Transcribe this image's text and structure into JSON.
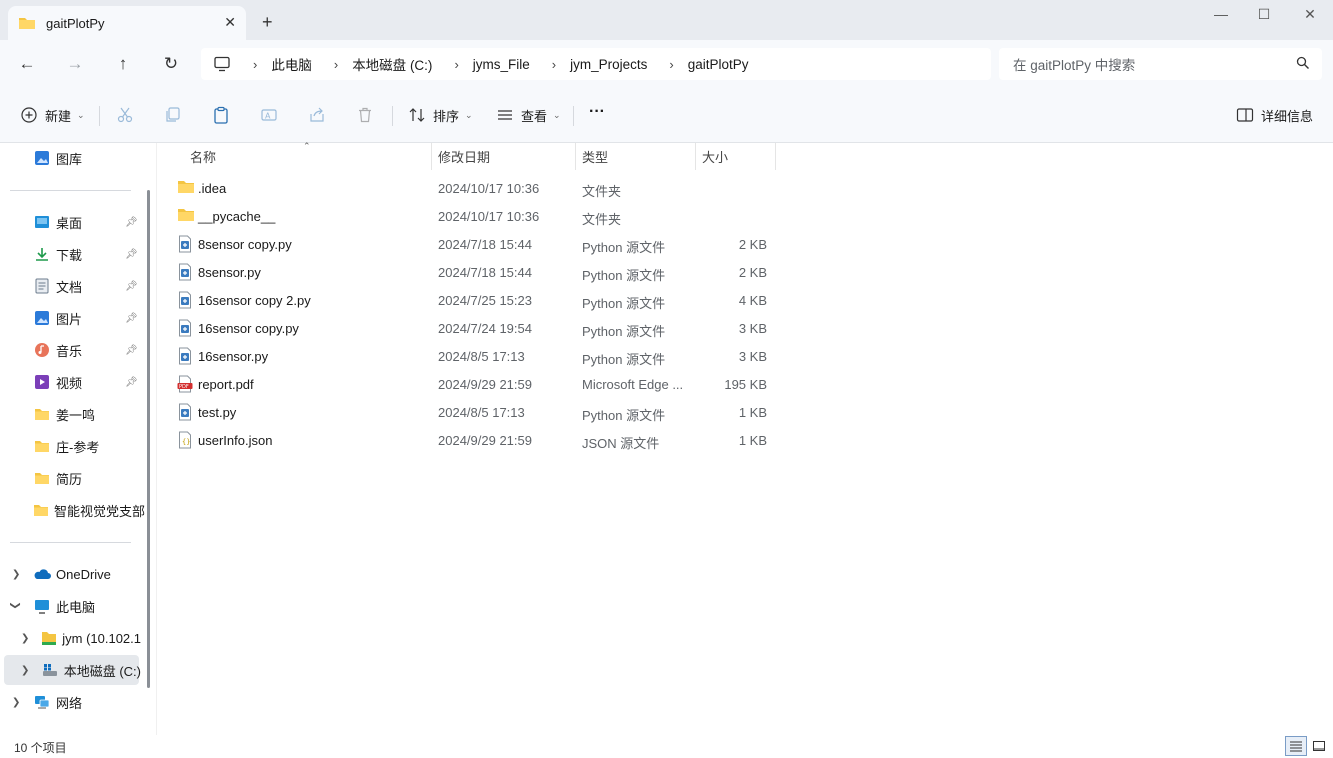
{
  "window": {
    "tab_title": "gaitPlotPy",
    "close_tab": "✕",
    "new_tab": "+",
    "minimize": "—",
    "maximize": "☐",
    "close": "✕"
  },
  "nav": {
    "back": "←",
    "forward": "→",
    "up": "↑",
    "refresh": "↻"
  },
  "breadcrumb": [
    "此电脑",
    "本地磁盘 (C:)",
    "jyms_File",
    "jym_Projects",
    "gaitPlotPy"
  ],
  "search": {
    "placeholder": "在 gaitPlotPy 中搜索"
  },
  "toolbar": {
    "new_label": "新建",
    "sort_label": "排序",
    "view_label": "查看",
    "more_label": "···",
    "details_label": "详细信息"
  },
  "sidebar": {
    "top_item": {
      "label": "图库",
      "icon": "gallery-icon"
    },
    "quick_access": [
      {
        "label": "桌面",
        "icon": "desktop-icon",
        "pinned": true
      },
      {
        "label": "下载",
        "icon": "download-icon",
        "pinned": true
      },
      {
        "label": "文档",
        "icon": "document-icon",
        "pinned": true
      },
      {
        "label": "图片",
        "icon": "picture-icon",
        "pinned": true
      },
      {
        "label": "音乐",
        "icon": "music-icon",
        "pinned": true
      },
      {
        "label": "视频",
        "icon": "video-icon",
        "pinned": true
      },
      {
        "label": "姜一鸣",
        "icon": "folder-icon",
        "pinned": false
      },
      {
        "label": "庄-参考",
        "icon": "folder-icon",
        "pinned": false
      },
      {
        "label": "简历",
        "icon": "folder-icon",
        "pinned": false
      },
      {
        "label": "智能视觉党支部",
        "icon": "folder-icon",
        "pinned": false
      }
    ],
    "tree": [
      {
        "label": "OneDrive",
        "icon": "onedrive-icon"
      },
      {
        "label": "此电脑",
        "icon": "this-pc-icon"
      },
      {
        "label": "jym (10.102.1",
        "icon": "network-drive-icon"
      },
      {
        "label": "本地磁盘 (C:)",
        "icon": "local-disk-icon"
      },
      {
        "label": "网络",
        "icon": "network-icon"
      }
    ]
  },
  "columns": {
    "name": "名称",
    "date": "修改日期",
    "type": "类型",
    "size": "大小"
  },
  "files": [
    {
      "name": ".idea",
      "date": "2024/10/17 10:36",
      "type": "文件夹",
      "size": "",
      "icon": "folder-icon"
    },
    {
      "name": "__pycache__",
      "date": "2024/10/17 10:36",
      "type": "文件夹",
      "size": "",
      "icon": "folder-icon"
    },
    {
      "name": "8sensor copy.py",
      "date": "2024/7/18 15:44",
      "type": "Python 源文件",
      "size": "2 KB",
      "icon": "python-file-icon"
    },
    {
      "name": "8sensor.py",
      "date": "2024/7/18 15:44",
      "type": "Python 源文件",
      "size": "2 KB",
      "icon": "python-file-icon"
    },
    {
      "name": "16sensor copy 2.py",
      "date": "2024/7/25 15:23",
      "type": "Python 源文件",
      "size": "4 KB",
      "icon": "python-file-icon"
    },
    {
      "name": "16sensor copy.py",
      "date": "2024/7/24 19:54",
      "type": "Python 源文件",
      "size": "3 KB",
      "icon": "python-file-icon"
    },
    {
      "name": "16sensor.py",
      "date": "2024/8/5 17:13",
      "type": "Python 源文件",
      "size": "3 KB",
      "icon": "python-file-icon"
    },
    {
      "name": "report.pdf",
      "date": "2024/9/29 21:59",
      "type": "Microsoft Edge ...",
      "size": "195 KB",
      "icon": "pdf-file-icon"
    },
    {
      "name": "test.py",
      "date": "2024/8/5 17:13",
      "type": "Python 源文件",
      "size": "1 KB",
      "icon": "python-file-icon"
    },
    {
      "name": "userInfo.json",
      "date": "2024/9/29 21:59",
      "type": "JSON 源文件",
      "size": "1 KB",
      "icon": "json-file-icon"
    }
  ],
  "status": {
    "item_count": "10 个项目"
  },
  "colors": {
    "folder": "#f4c542",
    "accent": "#0067c0",
    "pdf": "#d32f2f"
  }
}
